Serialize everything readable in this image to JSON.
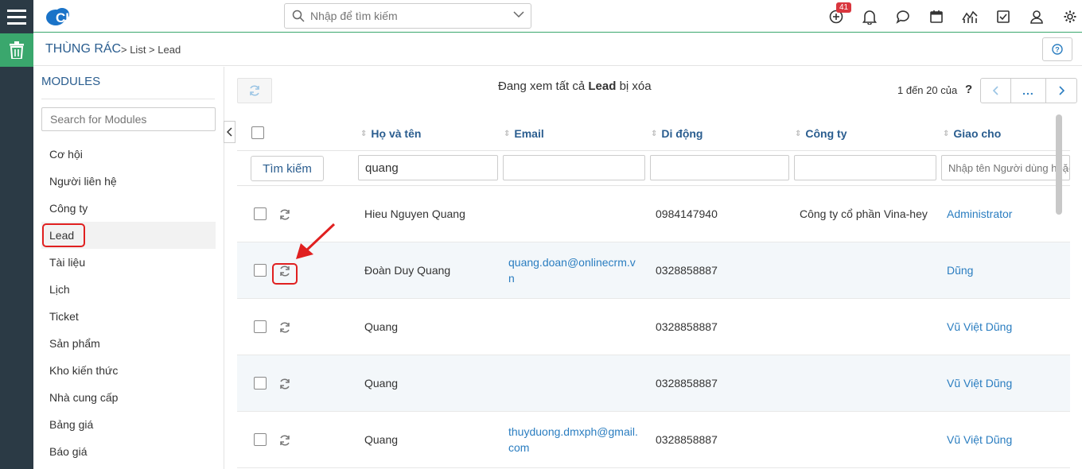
{
  "app": {
    "logo_text": "CLOUDPRO"
  },
  "topbar": {
    "search_placeholder": "Nhập để tìm kiếm",
    "notification_count": "41",
    "icons": [
      "plus-circle-icon",
      "bell-icon",
      "chat-icon",
      "calendar-icon",
      "chart-icon",
      "checkbox-icon",
      "user-icon",
      "gear-icon"
    ]
  },
  "breadcrumb": {
    "title": "THÙNG RÁC",
    "path": "> List > Lead"
  },
  "sidebar": {
    "heading": "MODULES",
    "search_placeholder": "Search for Modules",
    "items": [
      "Cơ hội",
      "Người liên hệ",
      "Công ty",
      "Lead",
      "Tài liệu",
      "Lịch",
      "Ticket",
      "Sản phẩm",
      "Kho kiến thức",
      "Nhà cung cấp",
      "Bảng giá",
      "Báo giá"
    ],
    "active_index": 3
  },
  "main": {
    "viewing_prefix": "Đang xem tất cả ",
    "viewing_module": "Lead",
    "viewing_suffix": " bị xóa",
    "pager_text": "1 đến 20 của",
    "pager_unknown": "?",
    "pager_more": "..."
  },
  "table": {
    "columns": [
      "Họ và tên",
      "Email",
      "Di động",
      "Công ty",
      "Giao cho"
    ],
    "search_button": "Tìm kiếm",
    "filter_name_value": "quang",
    "filter_assign_placeholder": "Nhập tên Người dùng hoặc",
    "rows": [
      {
        "name": "Hieu Nguyen Quang",
        "email": "",
        "mobile": "0984147940",
        "company": "Công ty cổ phần Vina-hey",
        "assigned": "Administrator"
      },
      {
        "name": "Đoàn Duy Quang",
        "email": "quang.doan@onlinecrm.v\nn",
        "mobile": "0328858887",
        "company": "",
        "assigned": "Dũng"
      },
      {
        "name": "Quang",
        "email": "",
        "mobile": "0328858887",
        "company": "",
        "assigned": "Vũ Việt Dũng"
      },
      {
        "name": "Quang",
        "email": "",
        "mobile": "0328858887",
        "company": "",
        "assigned": "Vũ Việt Dũng"
      },
      {
        "name": "Quang",
        "email": "thuyduong.dmxph@gmail.\ncom",
        "mobile": "0328858887",
        "company": "",
        "assigned": "Vũ Việt Dũng"
      }
    ]
  },
  "colors": {
    "accent": "#3aa76d",
    "link": "#2a7dc0",
    "heading": "#2a5d8f",
    "rail": "#2b3a45",
    "highlight": "#e02020"
  }
}
